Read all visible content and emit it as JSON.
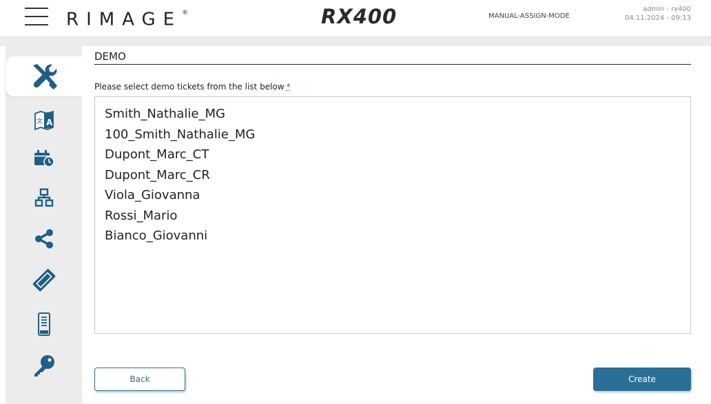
{
  "header": {
    "brand": "RIMAGE",
    "brand_mark": "®",
    "product": "RX400",
    "mode": "MANUAL-ASSIGN-MODE",
    "user": "admin - rx400",
    "datetime": "04.11.2024 - 09:13",
    "menu_icon": "hamburger-menu-icon"
  },
  "sidebar": {
    "items": [
      {
        "icon": "tools-icon",
        "active": true
      },
      {
        "icon": "language-icon",
        "active": false
      },
      {
        "icon": "calendar-clock-icon",
        "active": false
      },
      {
        "icon": "network-icon",
        "active": false
      },
      {
        "icon": "share-icon",
        "active": false
      },
      {
        "icon": "ticket-icon",
        "active": false
      },
      {
        "icon": "device-icon",
        "active": false
      },
      {
        "icon": "key-icon",
        "active": false
      }
    ]
  },
  "main": {
    "title": "DEMO",
    "prompt": "Please select demo tickets from the list below",
    "required_marker": "*",
    "tickets": [
      "Smith_Nathalie_MG",
      "100_Smith_Nathalie_MG",
      "Dupont_Marc_CT",
      "Dupont_Marc_CR",
      "Viola_Giovanna",
      "Rossi_Mario",
      "Bianco_Giovanni"
    ],
    "back_label": "Back",
    "create_label": "Create"
  },
  "colors": {
    "accent": "#2a6f97",
    "sidebar_bg": "#ececec",
    "icon": "#1e5f86"
  }
}
